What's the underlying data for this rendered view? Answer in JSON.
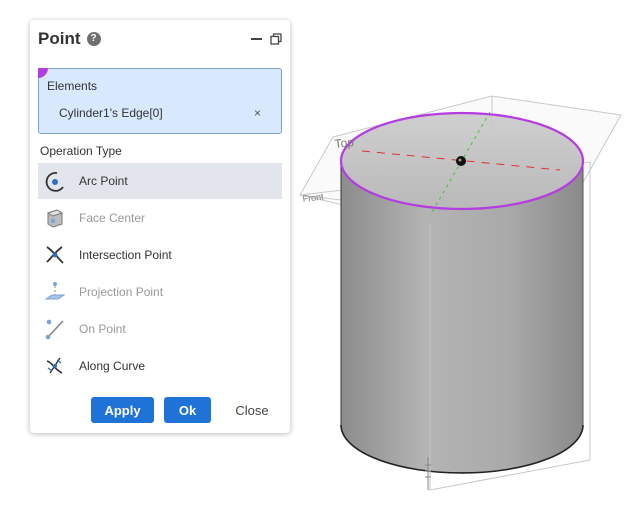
{
  "dialog": {
    "title": "Point",
    "help_glyph": "?",
    "elements_label": "Elements",
    "selected_element": "Cylinder1's Edge[0]",
    "remove_glyph": "×",
    "operation_type_label": "Operation Type",
    "operations": [
      {
        "label": "Arc Point",
        "icon": "arc-point-icon",
        "state": "selected"
      },
      {
        "label": "Face Center",
        "icon": "face-center-icon",
        "state": "disabled"
      },
      {
        "label": "Intersection Point",
        "icon": "intersection-point-icon",
        "state": "enabled"
      },
      {
        "label": "Projection Point",
        "icon": "projection-point-icon",
        "state": "disabled"
      },
      {
        "label": "On Point",
        "icon": "on-point-icon",
        "state": "disabled"
      },
      {
        "label": "Along Curve",
        "icon": "along-curve-icon",
        "state": "enabled"
      }
    ],
    "buttons": {
      "apply": "Apply",
      "ok": "Ok",
      "close": "Close"
    }
  },
  "viewport": {
    "top_plane_label": "Top",
    "front_plane_label": "Front",
    "highlight_color": "#b43ce0",
    "axis_color": "#e03030"
  },
  "colors": {
    "primary": "#1f73d6",
    "selection_bg": "#d8e9fd",
    "selected_row_bg": "#e2e5ec"
  }
}
